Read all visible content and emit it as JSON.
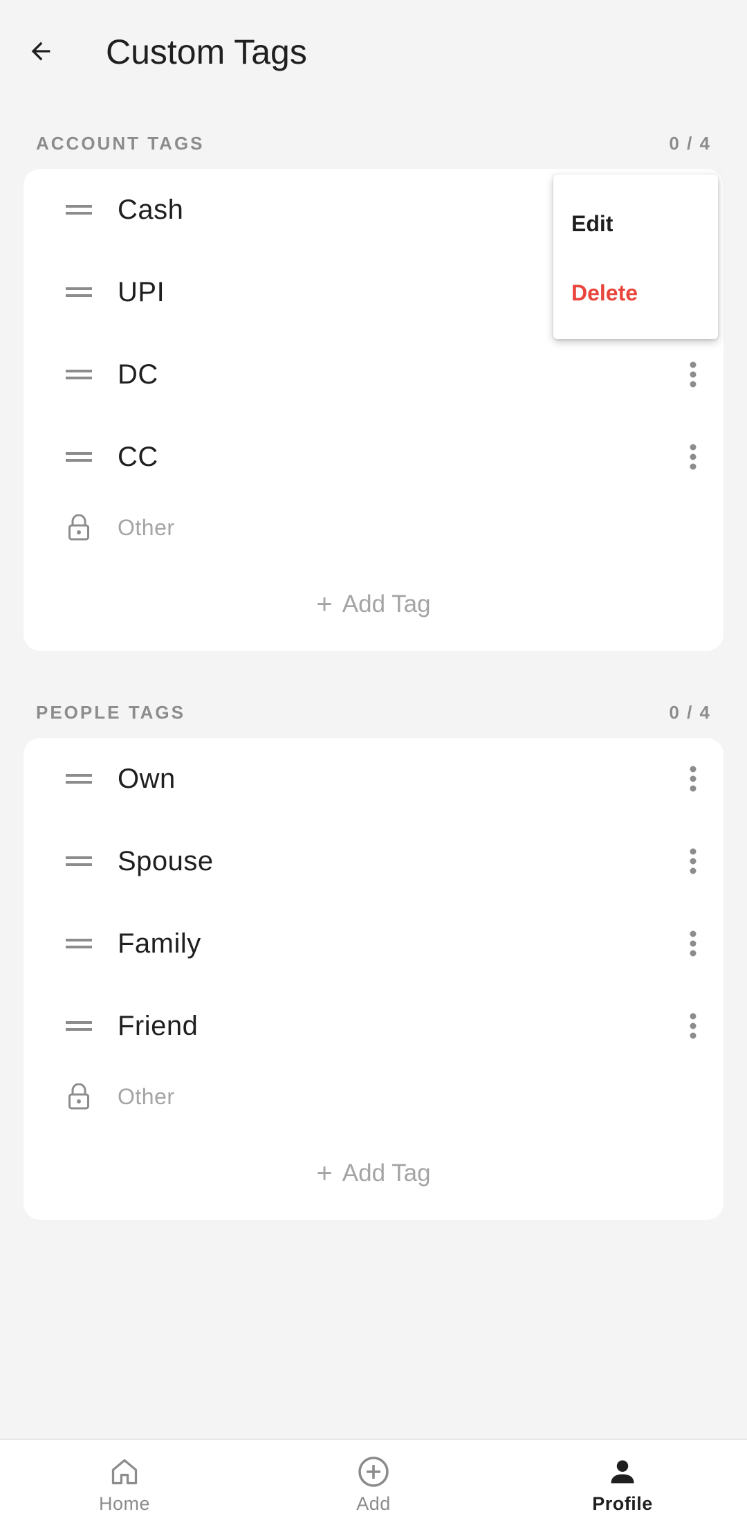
{
  "header": {
    "title": "Custom Tags"
  },
  "account_tags": {
    "label": "ACCOUNT TAGS",
    "count": "0 / 4",
    "items": [
      {
        "label": "Cash"
      },
      {
        "label": "UPI"
      },
      {
        "label": "DC"
      },
      {
        "label": "CC"
      }
    ],
    "locked_label": "Other",
    "add_label": "Add Tag"
  },
  "people_tags": {
    "label": "PEOPLE TAGS",
    "count": "0 / 4",
    "items": [
      {
        "label": "Own"
      },
      {
        "label": "Spouse"
      },
      {
        "label": "Family"
      },
      {
        "label": "Friend"
      }
    ],
    "locked_label": "Other",
    "add_label": "Add Tag"
  },
  "popup_menu": {
    "edit_label": "Edit",
    "delete_label": "Delete"
  },
  "bottom_nav": {
    "home_label": "Home",
    "add_label": "Add",
    "profile_label": "Profile"
  },
  "colors": {
    "background": "#f4f4f4",
    "card": "#ffffff",
    "muted": "#8c8c8c",
    "danger": "#e8453c"
  },
  "icons": {
    "back": "arrow-left-icon",
    "drag": "drag-handle-icon",
    "more": "more-vertical-icon",
    "lock": "lock-icon",
    "home": "home-icon",
    "add": "add-circle-icon",
    "profile": "person-icon"
  }
}
